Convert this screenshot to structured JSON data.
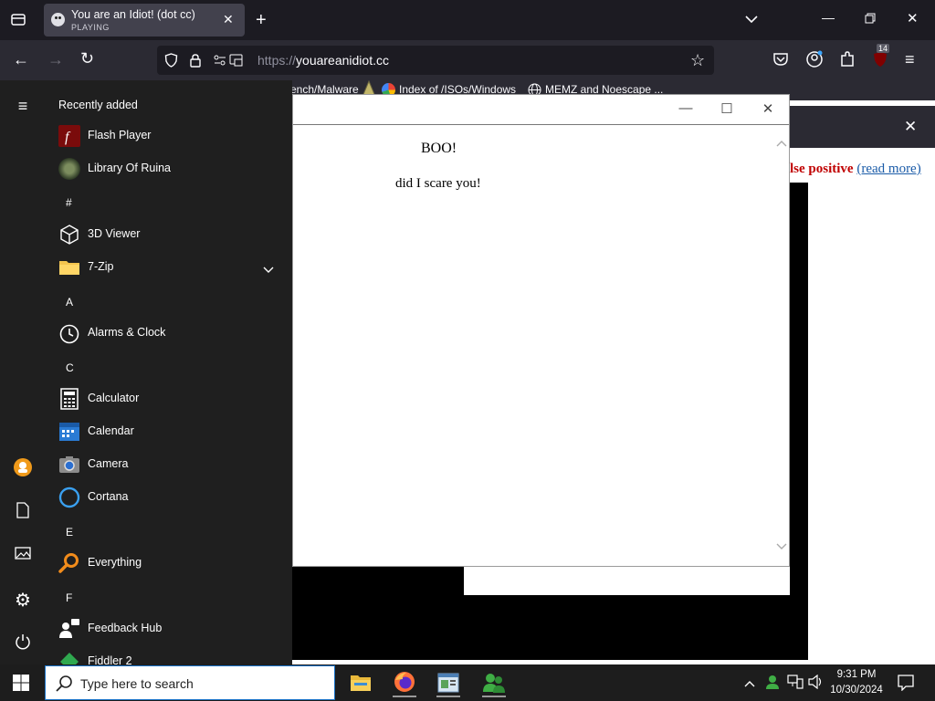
{
  "browser": {
    "tab": {
      "title": "You are an Idiot! (dot cc)",
      "status": "PLAYING"
    },
    "url": {
      "protocol": "https://",
      "host": "youareanidiot.cc"
    },
    "bookmarks": [
      {
        "label": "ench/Malware"
      },
      {
        "label": "Index of /ISOs/Windows"
      },
      {
        "label": "MEMZ and Noescape ..."
      }
    ],
    "extension_badge": "14"
  },
  "page": {
    "warning_text": "lse positive",
    "read_more": "(read more)"
  },
  "popup": {
    "heading": "BOO!",
    "message": "did I scare you!"
  },
  "start_menu": {
    "section_title": "Recently added",
    "recent": [
      {
        "label": "Flash Player",
        "icon": "flash-player-icon"
      },
      {
        "label": "Library Of Ruina",
        "icon": "library-of-ruina-icon"
      }
    ],
    "groups": [
      {
        "letter": "#",
        "apps": [
          {
            "label": "3D Viewer",
            "icon": "cube-icon"
          },
          {
            "label": "7-Zip",
            "icon": "folder-icon"
          }
        ]
      },
      {
        "letter": "A",
        "apps": [
          {
            "label": "Alarms & Clock",
            "icon": "clock-icon"
          }
        ]
      },
      {
        "letter": "C",
        "apps": [
          {
            "label": "Calculator",
            "icon": "calculator-icon"
          },
          {
            "label": "Calendar",
            "icon": "calendar-icon"
          },
          {
            "label": "Camera",
            "icon": "camera-icon"
          },
          {
            "label": "Cortana",
            "icon": "cortana-icon"
          }
        ]
      },
      {
        "letter": "E",
        "apps": [
          {
            "label": "Everything",
            "icon": "magnifier-icon"
          }
        ]
      },
      {
        "letter": "F",
        "apps": [
          {
            "label": "Feedback Hub",
            "icon": "feedback-icon"
          },
          {
            "label": "Fiddler 2",
            "icon": "fiddler-icon"
          }
        ]
      }
    ]
  },
  "taskbar": {
    "search_placeholder": "Type here to search",
    "time": "9:31 PM",
    "date": "10/30/2024"
  }
}
